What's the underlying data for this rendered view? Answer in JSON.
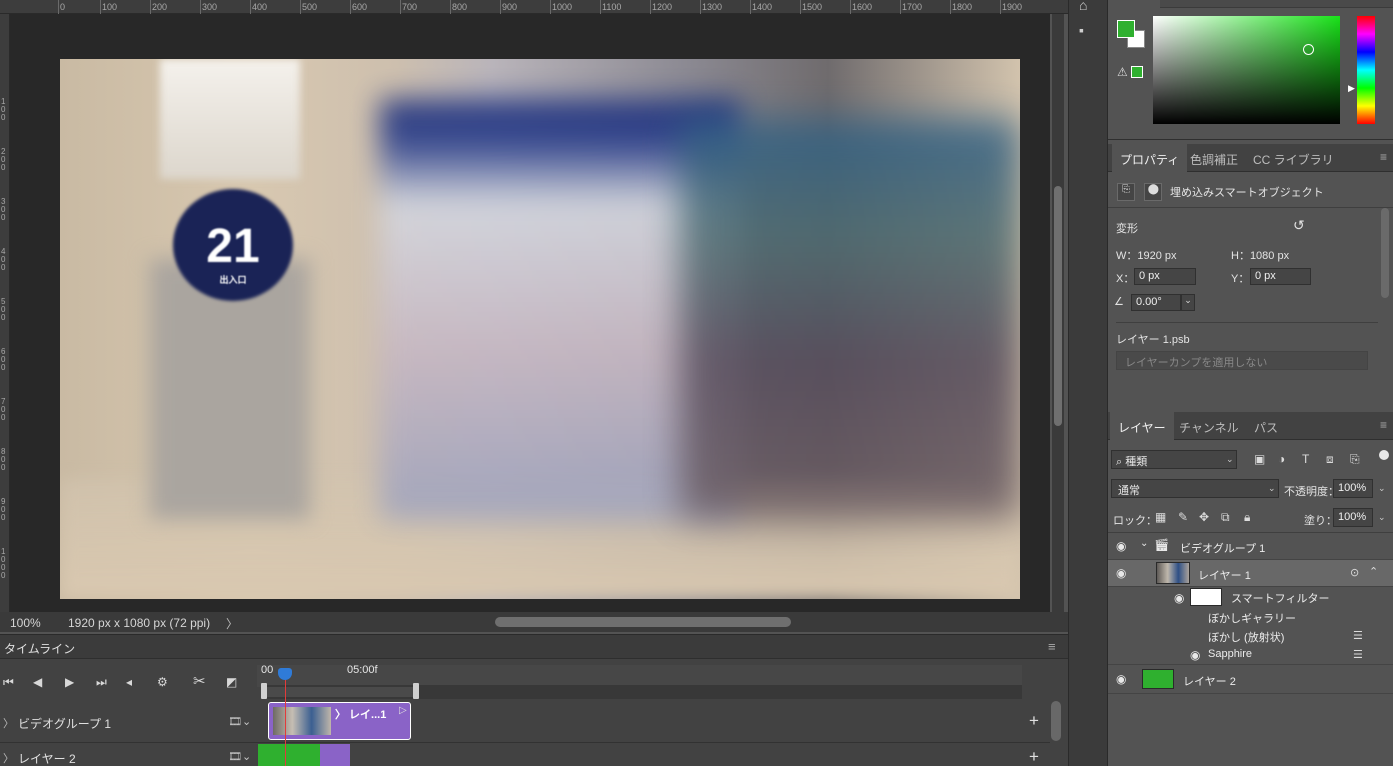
{
  "ruler": {
    "h_ticks": [
      "0",
      "100",
      "200",
      "300",
      "400",
      "500",
      "600",
      "700",
      "800",
      "900",
      "1000",
      "1100",
      "1200",
      "1300",
      "1400",
      "1500",
      "1600",
      "1700",
      "1800",
      "1900"
    ],
    "v_ticks": [
      "1 0 0",
      "2 0 0",
      "3 0 0",
      "4 0 0",
      "5 0 0",
      "6 0 0",
      "7 0 0",
      "8 0 0",
      "9 0 0",
      "1 0 0 0"
    ]
  },
  "canvas": {
    "sign_number": "21",
    "sign_sub": "出入口"
  },
  "status": {
    "zoom": "100%",
    "doc_info": "1920 px x 1080 px (72 ppi)",
    "arrow": "〉"
  },
  "timeline": {
    "title": "タイムライン",
    "time_start": "00",
    "time_mark": "05:00f",
    "tracks": [
      {
        "name": "ビデオグループ 1",
        "clip_label": "〉 レイ...1"
      },
      {
        "name": "レイヤー 2"
      }
    ]
  },
  "properties": {
    "tabs": [
      "プロパティ",
      "色調補正",
      "CC ライブラリ"
    ],
    "type": "埋め込みスマートオブジェクト",
    "transform_label": "変形",
    "w_label": "W：1920 px",
    "h_label": "H：1080 px",
    "x_label": "X：",
    "x_value": "0 px",
    "y_label": "Y：",
    "y_value": "0 px",
    "angle_value": "0.00°",
    "file_name": "レイヤー 1.psb",
    "layer_comp_placeholder": "レイヤーカンプを適用しない"
  },
  "layers": {
    "tabs": [
      "レイヤー",
      "チャンネル",
      "パス"
    ],
    "filter_kind": "種類",
    "blend_mode": "通常",
    "opacity_label": "不透明度：",
    "opacity_value": "100%",
    "lock_label": "ロック：",
    "fill_label": "塗り：",
    "fill_value": "100%",
    "items": [
      {
        "name": "ビデオグループ 1"
      },
      {
        "name": "レイヤー 1"
      },
      {
        "name": "スマートフィルター"
      },
      {
        "name": "ぼかしギャラリー"
      },
      {
        "name": "ぼかし (放射状)"
      },
      {
        "name": "Sapphire"
      },
      {
        "name": "レイヤー 2"
      }
    ]
  },
  "colors": {
    "foreground": "#2fb02f",
    "background": "#ffffff",
    "clip_video": "#8a63c7",
    "playhead": "#2f7bd8"
  },
  "icons": [
    "home-icon",
    "comment-icon",
    "search-icon",
    "gear-icon",
    "scissors-icon",
    "eye-icon",
    "lock-icon",
    "filmstrip-icon",
    "plus-icon",
    "menu-icon",
    "reset-icon"
  ]
}
